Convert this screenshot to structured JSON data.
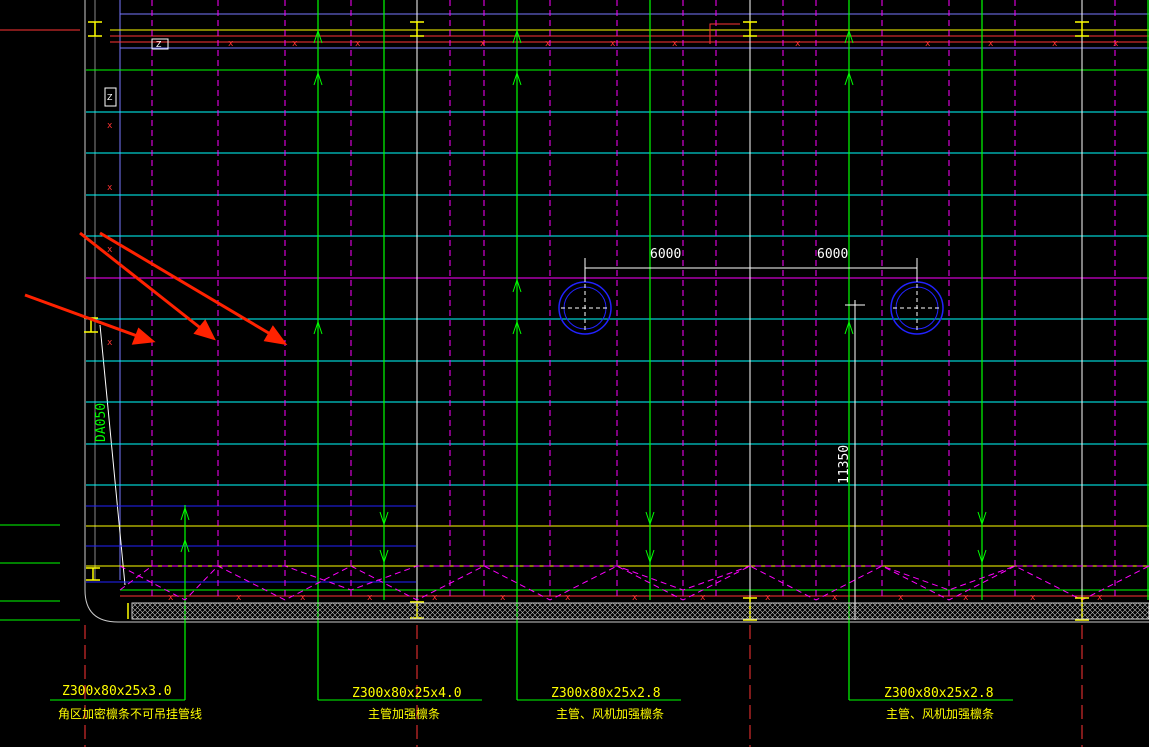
{
  "colors": {
    "background": "#000000",
    "purlin": "#00ff00",
    "grid_dashed": "#ff00ff",
    "cyan_line": "#00ffff",
    "blue_line": "#2222ff",
    "red_line": "#ff3333",
    "yellow_line": "#ffff00",
    "white_line": "#ffffff",
    "arrow": "#ff2200"
  },
  "dimensions": {
    "span_left": "6000",
    "span_right": "6000",
    "vertical": "11350",
    "wall_label": "DA050"
  },
  "purlin_labels": [
    {
      "spec": "Z300x80x25x3.0",
      "note": "角区加密檩条不可吊挂管线"
    },
    {
      "spec": "Z300x80x25x4.0",
      "note": "主管加强檩条"
    },
    {
      "spec": "Z300x80x25x2.8",
      "note": "主管、风机加强檩条"
    },
    {
      "spec": "Z300x80x25x2.8",
      "note": "主管、风机加强檩条"
    }
  ],
  "markers": {
    "small_box_1": "Z",
    "small_box_2": "Z"
  },
  "annotation_arrows": {
    "count": 3
  },
  "fans": {
    "count": 2,
    "icon": "fan-opening-icon"
  }
}
